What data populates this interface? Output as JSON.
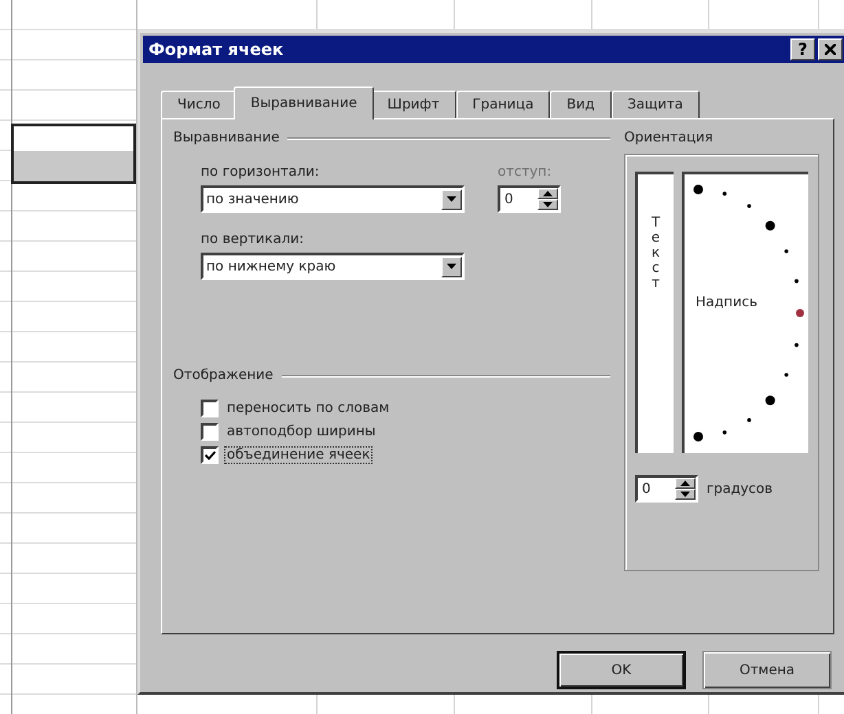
{
  "window": {
    "title": "Формат ячеек",
    "title_buttons": [
      {
        "kind": "help",
        "label": "?"
      },
      {
        "kind": "close"
      }
    ]
  },
  "tabs": [
    {
      "label": "Число",
      "selected": false
    },
    {
      "label": "Выравнивание",
      "selected": true
    },
    {
      "label": "Шрифт",
      "selected": false
    },
    {
      "label": "Граница",
      "selected": false
    },
    {
      "label": "Вид",
      "selected": false
    },
    {
      "label": "Защита",
      "selected": false
    }
  ],
  "alignment": {
    "title": "Выравнивание",
    "horizontal": {
      "label": "по горизонтали:",
      "value": "по значению"
    },
    "indent": {
      "label": "отступ:",
      "disabled": true,
      "value": "0"
    },
    "vertical": {
      "label": "по вертикали:",
      "value": "по нижнему краю"
    }
  },
  "orientation": {
    "title": "Ориентация",
    "vertical_text": "Текст",
    "label": "Надпись",
    "degrees": {
      "value": "0",
      "unit": "градусов"
    }
  },
  "display": {
    "title": "Отображение",
    "options": [
      {
        "label": "переносить по словам",
        "checked": false,
        "focused": false
      },
      {
        "label": "автоподбор ширины",
        "checked": false,
        "focused": false
      },
      {
        "label": "объединение ячеек",
        "checked": true,
        "focused": true
      }
    ]
  },
  "buttons": [
    {
      "label": "OK",
      "default": true
    },
    {
      "label": "Отмена",
      "default": false
    }
  ]
}
